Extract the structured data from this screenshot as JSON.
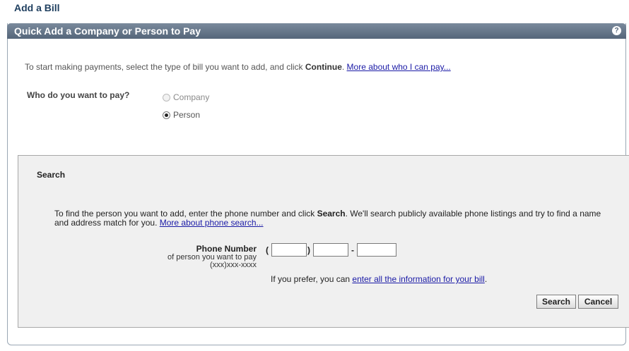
{
  "page": {
    "title": "Add a Bill"
  },
  "panel": {
    "header": "Quick Add a Company or Person to Pay",
    "help_icon": "?"
  },
  "intro": {
    "text_before": "To start making payments, select the type of bill you want to add, and click ",
    "bold": "Continue",
    "text_after": ". ",
    "link": "More about who I can pay..."
  },
  "who": {
    "label": "Who do you want to pay?",
    "options": [
      {
        "label": "Company",
        "checked": false,
        "disabled": true
      },
      {
        "label": "Person",
        "checked": true,
        "disabled": false
      }
    ]
  },
  "search": {
    "title": "Search",
    "desc_before": "To find the person you want to add, enter the phone number and click ",
    "desc_bold": "Search",
    "desc_after": ". We'll search publicly available phone listings and try to find a name and address match for you. ",
    "desc_link": "More about phone search...",
    "phone_label": "Phone Number",
    "phone_sublabel": "of person you want to pay",
    "phone_format": "(xxx)xxx-xxxx",
    "area_code": "",
    "prefix": "",
    "line": "",
    "paren_open": "(",
    "paren_close": ")",
    "dash": "-",
    "prefer_before": "If you prefer, you can ",
    "prefer_link": "enter all the information for your bill",
    "prefer_after": ".",
    "search_button": "Search",
    "cancel_button": "Cancel"
  },
  "colors": {
    "header_bg": "#55667a",
    "title": "#1f3f5f",
    "link": "#1a1aa6",
    "search_bg": "#f0f0f0"
  }
}
